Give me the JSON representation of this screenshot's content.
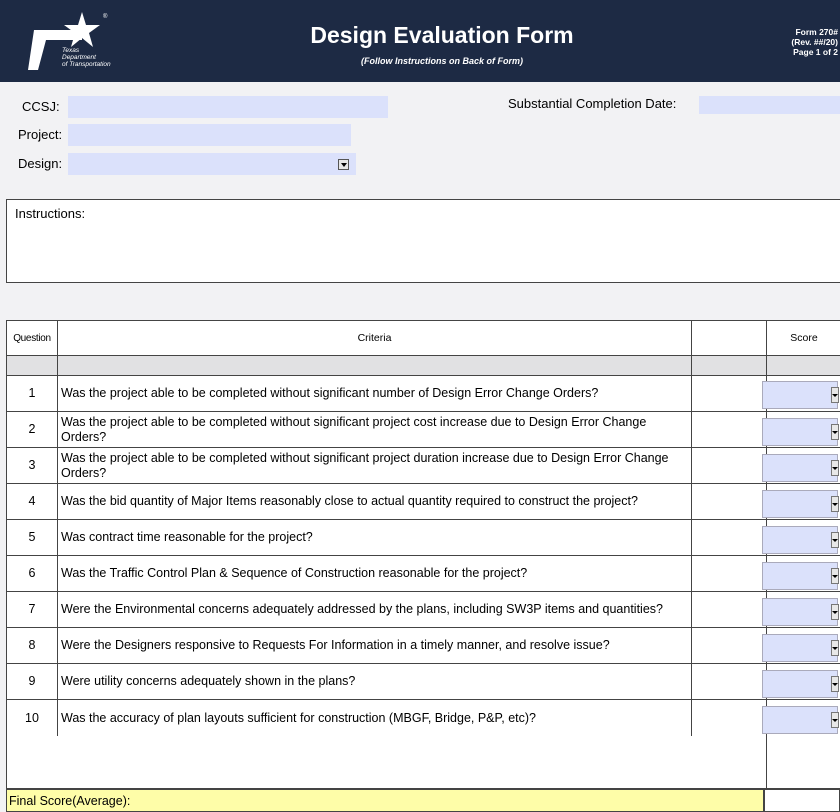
{
  "header": {
    "agency_text": "Texas\nDepartment\nof Transportation",
    "registered": "®",
    "title": "Design Evaluation Form",
    "subtitle": "(Follow Instructions on Back of Form)",
    "form_number": "Form 270#",
    "revision": "(Rev. ##/20)",
    "page": "Page 1 of 2"
  },
  "fields": {
    "ccsj_label": "CCSJ:",
    "project_label": "Project:",
    "design_label": "Design:",
    "completion_label": "Substantial Completion Date:"
  },
  "instructions_label": "Instructions:",
  "table": {
    "headers": {
      "question": "Question",
      "criteria": "Criteria",
      "score": "Score"
    },
    "rows": [
      {
        "n": "1",
        "text": "Was the project able to be completed without significant number of Design Error Change Orders?"
      },
      {
        "n": "2",
        "text": "Was the project able to be completed without significant project cost increase due to Design Error Change Orders?"
      },
      {
        "n": "3",
        "text": "Was the project able to be completed without significant project duration increase due to Design Error Change Orders?"
      },
      {
        "n": "4",
        "text": "Was the bid quantity of Major Items reasonably close to actual quantity required to construct the project?"
      },
      {
        "n": "5",
        "text": "Was contract time reasonable for the project?"
      },
      {
        "n": "6",
        "text": "Was the Traffic Control Plan & Sequence of Construction reasonable for the project?"
      },
      {
        "n": "7",
        "text": "Were the Environmental concerns adequately addressed by the plans, including SW3P items and quantities?"
      },
      {
        "n": "8",
        "text": "Were the Designers responsive to Requests For Information in a timely manner, and resolve issue?"
      },
      {
        "n": "9",
        "text": "Were utility concerns adequately shown in the plans?"
      },
      {
        "n": "10",
        "text": "Was the accuracy of plan layouts sufficient for construction (MBGF, Bridge, P&P, etc)?"
      }
    ],
    "final_label": "Final Score(Average):"
  },
  "colors": {
    "header_bg": "#1d2a44",
    "field_bg": "#dbe1fb",
    "final_bg": "#fefda8"
  }
}
